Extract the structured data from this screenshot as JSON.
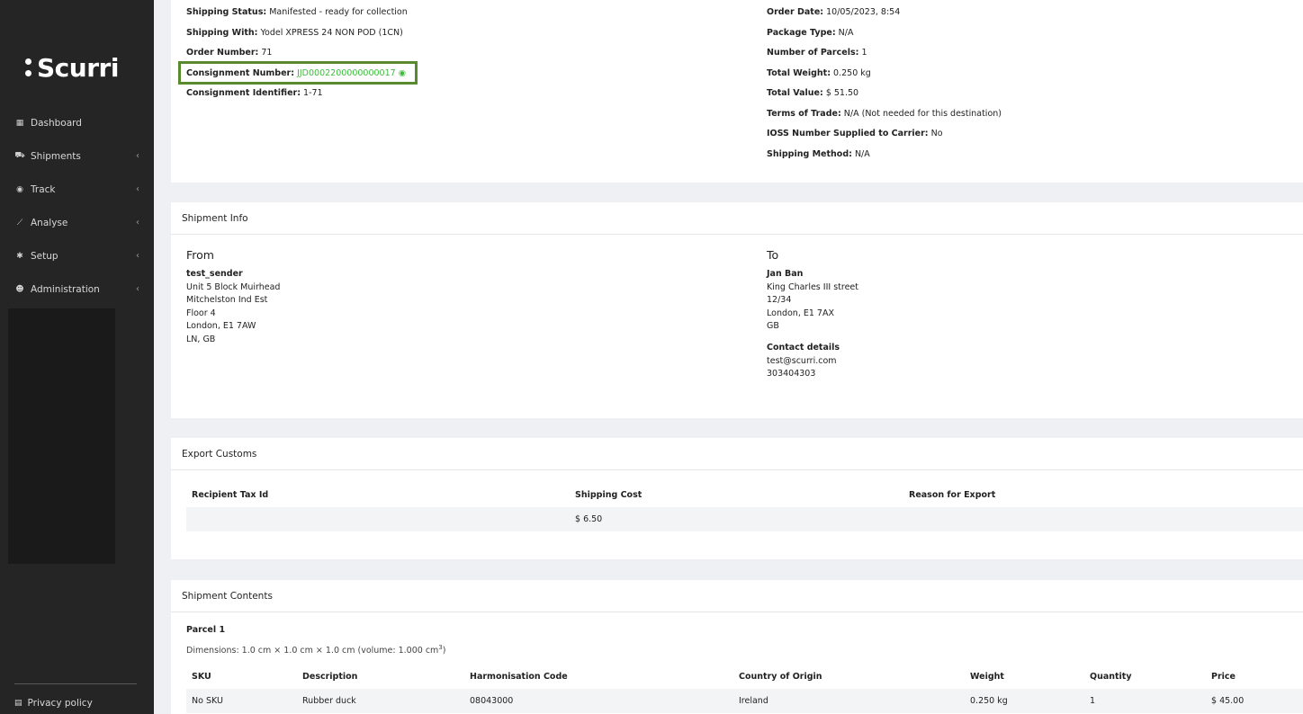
{
  "sidebar": {
    "logo": "Scurri",
    "items": [
      {
        "label": "Dashboard",
        "icon": "grid-icon",
        "chevron": false
      },
      {
        "label": "Shipments",
        "icon": "truck-icon",
        "chevron": true
      },
      {
        "label": "Track",
        "icon": "target-icon",
        "chevron": true
      },
      {
        "label": "Analyse",
        "icon": "chart-icon",
        "chevron": true
      },
      {
        "label": "Setup",
        "icon": "gear-icon",
        "chevron": true
      },
      {
        "label": "Administration",
        "icon": "users-icon",
        "chevron": true
      }
    ],
    "privacy": "Privacy policy"
  },
  "details": {
    "left": [
      {
        "label": "Shipping Status:",
        "value": "Manifested - ready for collection"
      },
      {
        "label": "Shipping With:",
        "value": "Yodel XPRESS 24 NON POD (1CN)"
      },
      {
        "label": "Order Number:",
        "value": "71"
      },
      {
        "label": "Consignment Number:",
        "value": "JJD0002200000000017"
      },
      {
        "label": "Consignment Identifier:",
        "value": "1-71"
      }
    ],
    "right": [
      {
        "label": "Order Date:",
        "value": "10/05/2023, 8:54"
      },
      {
        "label": "Package Type:",
        "value": "N/A"
      },
      {
        "label": "Number of Parcels:",
        "value": "1"
      },
      {
        "label": "Total Weight:",
        "value": "0.250 kg"
      },
      {
        "label": "Total Value:",
        "value": "$ 51.50"
      },
      {
        "label": "Terms of Trade:",
        "value": "N/A (Not needed for this destination)"
      },
      {
        "label": "IOSS Number Supplied to Carrier:",
        "value": "No"
      },
      {
        "label": "Shipping Method:",
        "value": "N/A"
      }
    ]
  },
  "shipment_info": {
    "title": "Shipment Info",
    "from": {
      "heading": "From",
      "name": "test_sender",
      "lines": [
        "Unit 5 Block Muirhead",
        "Mitchelston Ind Est",
        "Floor 4",
        "London, E1 7AW",
        "LN, GB"
      ]
    },
    "to": {
      "heading": "To",
      "name": "Jan Ban",
      "lines": [
        "King Charles III street",
        "12/34",
        "London, E1 7AX",
        "GB"
      ],
      "contact_heading": "Contact details",
      "email": "test@scurri.com",
      "phone": "303404303"
    }
  },
  "export_customs": {
    "title": "Export Customs",
    "headers": [
      "Recipient Tax Id",
      "Shipping Cost",
      "Reason for Export"
    ],
    "row": [
      "",
      "$ 6.50",
      ""
    ]
  },
  "contents": {
    "title": "Shipment Contents",
    "parcel": "Parcel 1",
    "dimensions": "Dimensions: 1.0 cm × 1.0 cm × 1.0 cm (volume: 1.000 cm",
    "dimensions_sup": "3",
    "dimensions_end": ")",
    "headers": [
      "SKU",
      "Description",
      "Harmonisation Code",
      "Country of Origin",
      "Weight",
      "Quantity",
      "Price"
    ],
    "row": [
      "No SKU",
      "Rubber duck",
      "08043000",
      "Ireland",
      "0.250 kg",
      "1",
      "$ 45.00"
    ]
  },
  "colors": {
    "sidebar": "#252525",
    "link_green": "#3dbb3d",
    "highlight_border": "#5a8a2e"
  }
}
